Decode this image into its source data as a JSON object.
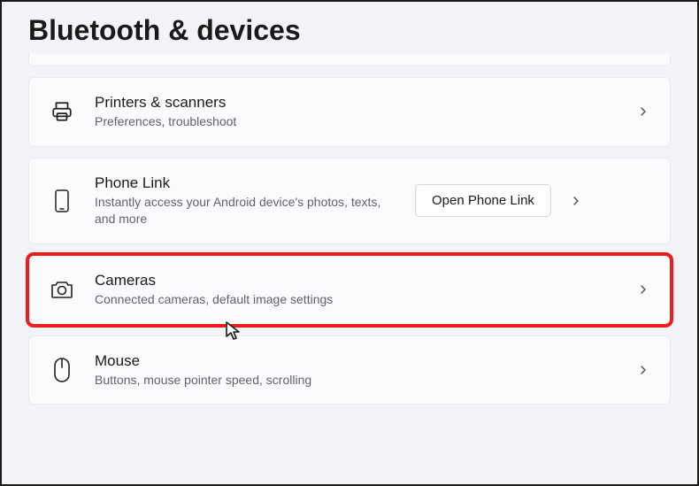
{
  "page_title": "Bluetooth & devices",
  "items": [
    {
      "title": "Printers & scanners",
      "subtitle": "Preferences, troubleshoot"
    },
    {
      "title": "Phone Link",
      "subtitle": "Instantly access your Android device's photos, texts, and more",
      "action_label": "Open Phone Link"
    },
    {
      "title": "Cameras",
      "subtitle": "Connected cameras, default image settings"
    },
    {
      "title": "Mouse",
      "subtitle": "Buttons, mouse pointer speed, scrolling"
    }
  ]
}
